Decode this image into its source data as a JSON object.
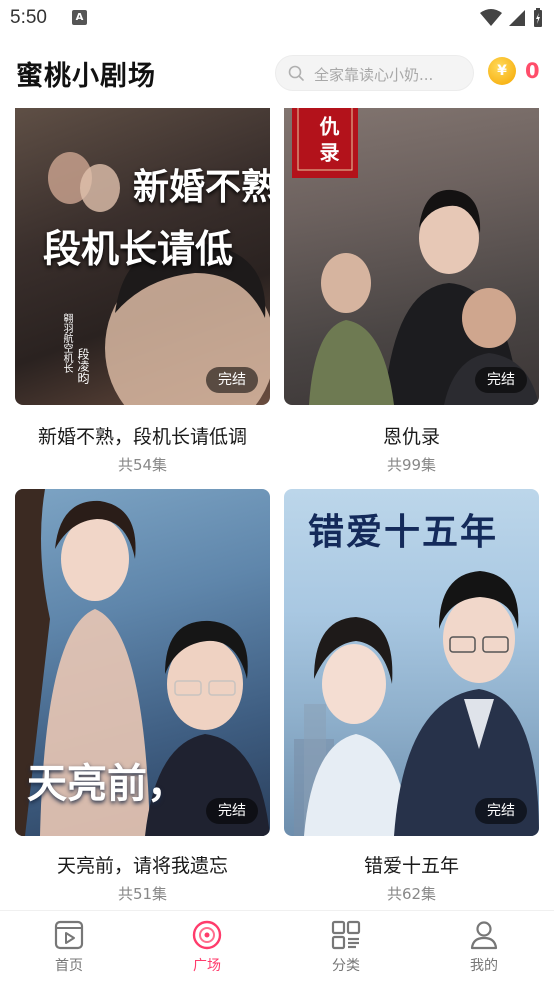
{
  "status_bar": {
    "time": "5:50"
  },
  "header": {
    "title": "蜜桃小剧场",
    "search_placeholder": "全家靠读心小奶...",
    "coin_value": "0"
  },
  "cards": [
    {
      "title": "新婚不熟，段机长请低调",
      "episodes": "共54集",
      "badge": "完结",
      "poster_text_main": "新婚不熟",
      "poster_text_sub": "段机长请低",
      "poster_side_text": "翱羽航空机长",
      "poster_name_text": "段凌昀"
    },
    {
      "title": "恩仇录",
      "episodes": "共99集",
      "badge": "完结",
      "poster_seal_text": "仇录"
    },
    {
      "title": "天亮前，请将我遗忘",
      "episodes": "共51集",
      "badge": "完结",
      "poster_text_main": "天亮前，"
    },
    {
      "title": "错爱十五年",
      "episodes": "共62集",
      "badge": "完结",
      "poster_text_main": "错爱十五年"
    }
  ],
  "bottom_nav": [
    {
      "label": "首页",
      "icon": "home-icon",
      "active": false
    },
    {
      "label": "广场",
      "icon": "plaza-icon",
      "active": true
    },
    {
      "label": "分类",
      "icon": "category-icon",
      "active": false
    },
    {
      "label": "我的",
      "icon": "profile-icon",
      "active": false
    }
  ],
  "colors": {
    "accent": "#ff3b6b",
    "coin_value": "#ff4d6a",
    "coin": "#f5a700"
  }
}
